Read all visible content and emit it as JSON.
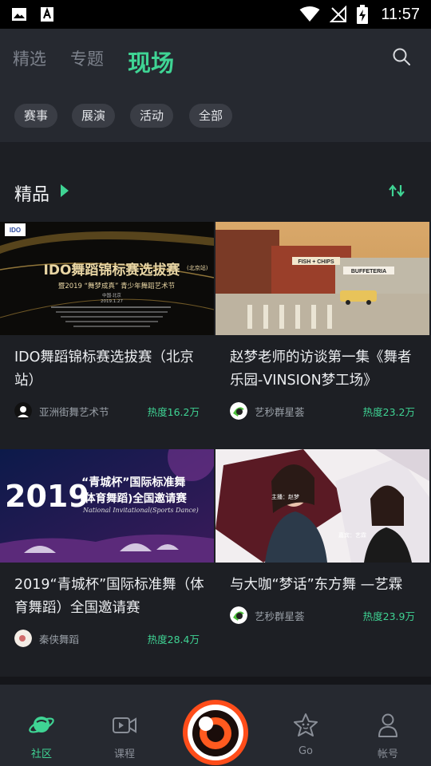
{
  "status_bar": {
    "time": "11:57"
  },
  "top_tabs": [
    {
      "label": "精选",
      "active": false
    },
    {
      "label": "专题",
      "active": false
    },
    {
      "label": "现场",
      "active": true
    }
  ],
  "filters": [
    "赛事",
    "展演",
    "活动",
    "全部"
  ],
  "section": {
    "title": "精品"
  },
  "cards": [
    {
      "title": "IDO舞蹈锦标赛选拔赛（北京站）",
      "author": "亚洲街舞艺术节",
      "heat": "热度16.2万",
      "thumb_text": {
        "logo": "IDO",
        "headline": "IDO舞蹈锦标赛选拔赛",
        "tag": "(北京站)",
        "sub": "暨2019 “舞梦成真” 青少年舞蹈艺术节",
        "place": "中国·北京",
        "date": "2019.1.27"
      }
    },
    {
      "title": "赵梦老师的访谈第一集《舞者乐园-VINSION梦工场》",
      "author": "艺秒群星荟",
      "heat": "热度23.2万",
      "thumb_text": {
        "sign1": "FISH + CHIPS",
        "sign2": "BUFFETERIA"
      }
    },
    {
      "title": "2019“青城杯”国际标准舞（体育舞蹈）全国邀请赛",
      "author": "秦侠舞蹈",
      "heat": "热度28.4万",
      "thumb_text": {
        "year": "2019",
        "line1": "“青城杯”国际标准舞",
        "line2": "(体育舞蹈)全国邀请赛",
        "line3": "National Invitational(Sports Dance)"
      }
    },
    {
      "title": "与大咖“梦话”东方舞 —艺霖",
      "author": "艺秒群星荟",
      "heat": "热度23.9万",
      "thumb_text": {
        "host": "主播：赵梦",
        "guest": "嘉宾：艺霖"
      }
    }
  ],
  "bottom_nav": [
    {
      "label": "社区",
      "icon": "planet-icon",
      "active": true
    },
    {
      "label": "课程",
      "icon": "video-icon",
      "active": false
    },
    {
      "label": "Go",
      "icon": "star-face-icon",
      "active": false
    },
    {
      "label": "帐号",
      "icon": "person-icon",
      "active": false
    }
  ],
  "colors": {
    "accent": "#3fd494",
    "background": "#1d1f24",
    "panel": "#262930",
    "record": "#ff4d1a"
  }
}
